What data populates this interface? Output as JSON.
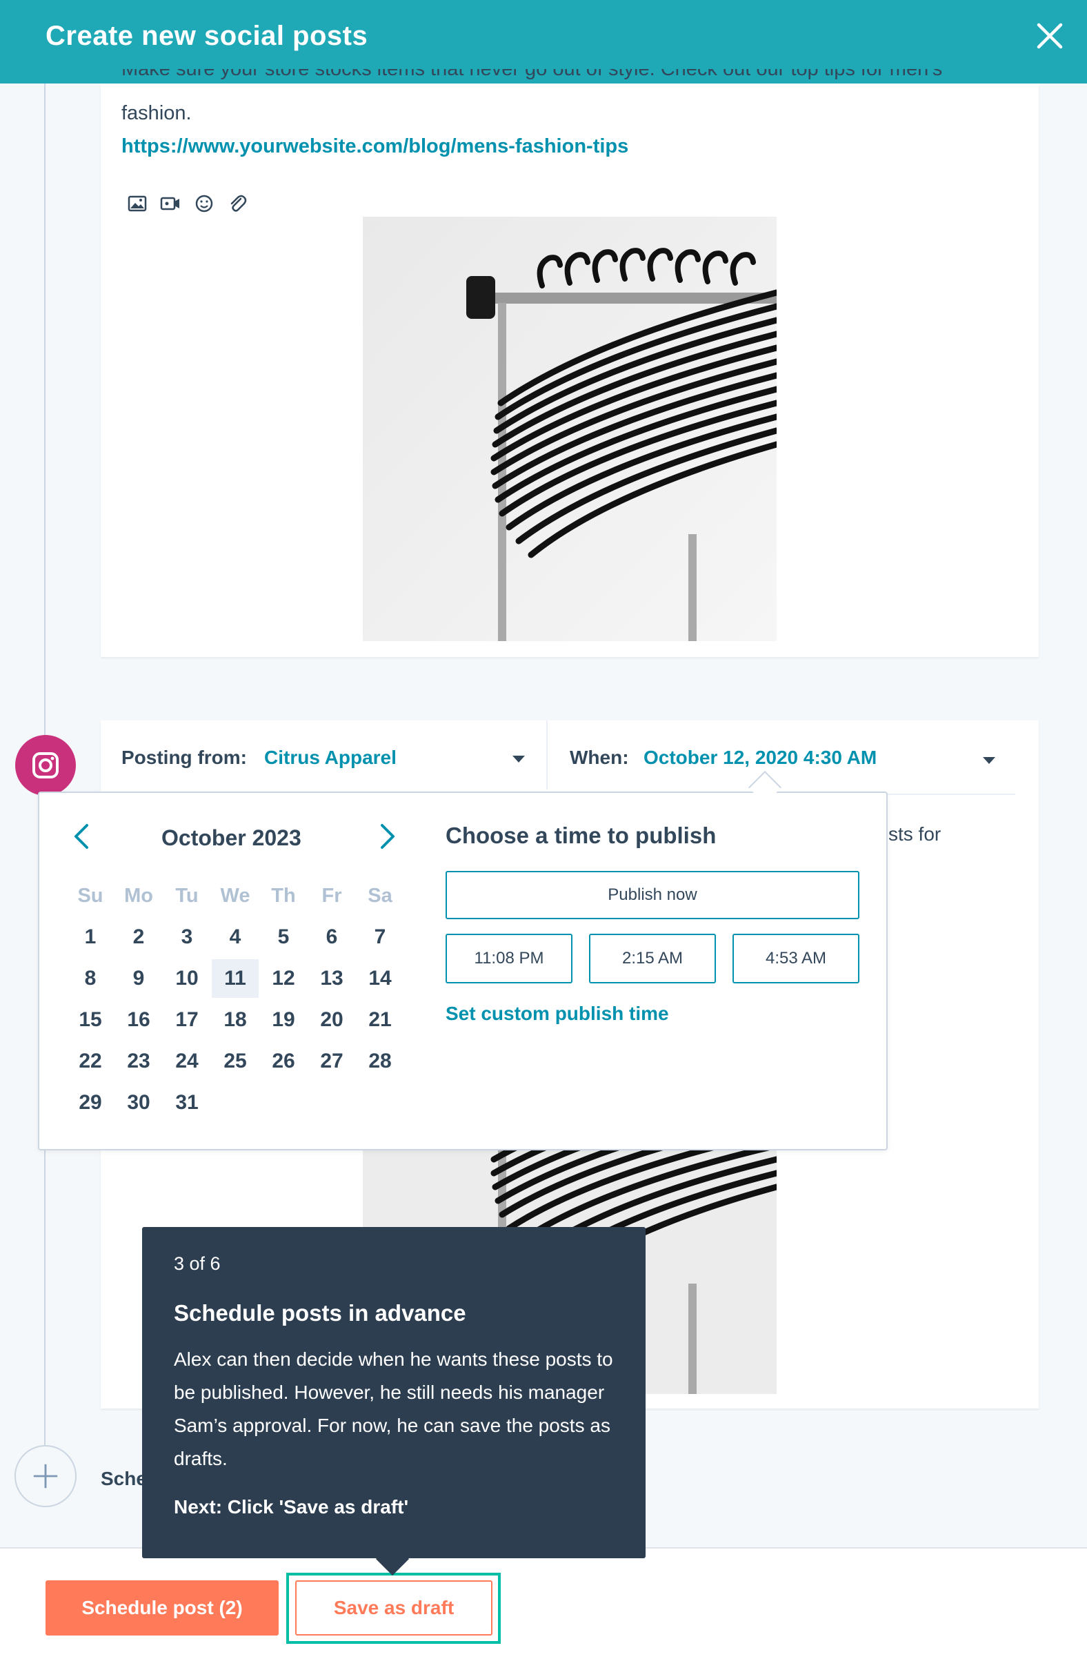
{
  "header": {
    "title": "Create new social posts",
    "close_icon": "close-icon"
  },
  "post1": {
    "cut_text": "Make sure your store stocks items that never go out of style. Check out our top tips for men's",
    "text": "fashion.",
    "link": "https://www.yourwebsite.com/blog/mens-fashion-tips",
    "toolbar_icons": [
      "image-icon",
      "video-icon",
      "emoji-icon",
      "attachment-icon"
    ],
    "image": "clothes-hangers-photo"
  },
  "post2": {
    "network_icon": "instagram-icon",
    "posting_from_label": "Posting from:",
    "posting_from_value": "Citrus Apparel",
    "when_label": "When:",
    "when_value": "October 12, 2020 4:30 AM",
    "partial_text": "sts for"
  },
  "datepicker": {
    "month": "October 2023",
    "weekdays": [
      "Su",
      "Mo",
      "Tu",
      "We",
      "Th",
      "Fr",
      "Sa"
    ],
    "weeks": [
      [
        "1",
        "2",
        "3",
        "4",
        "5",
        "6",
        "7"
      ],
      [
        "8",
        "9",
        "10",
        "11",
        "12",
        "13",
        "14"
      ],
      [
        "15",
        "16",
        "17",
        "18",
        "19",
        "20",
        "21"
      ],
      [
        "22",
        "23",
        "24",
        "25",
        "26",
        "27",
        "28"
      ],
      [
        "29",
        "30",
        "31"
      ]
    ],
    "highlighted_day": "11"
  },
  "time_picker": {
    "title": "Choose a time to publish",
    "publish_now": "Publish now",
    "slots": [
      "11:08 PM",
      "2:15 AM",
      "4:53 AM"
    ],
    "custom": "Set custom publish time"
  },
  "tooltip": {
    "step": "3 of 6",
    "title": "Schedule posts in advance",
    "body": "Alex can then decide when he wants these posts to be published. However, he still needs his manager Sam’s approval. For now, he can save the posts as drafts.",
    "next": "Next: Click 'Save as draft'"
  },
  "schedule_partial": "Sche",
  "footer": {
    "schedule_button": "Schedule post (2)",
    "draft_button": "Save as draft"
  },
  "colors": {
    "header": "#1fa8b6",
    "link": "#0091ae",
    "primary": "#ff7a59",
    "highlight": "#00bda5",
    "tooltip": "#2d3e50",
    "instagram": "#c9317c"
  }
}
